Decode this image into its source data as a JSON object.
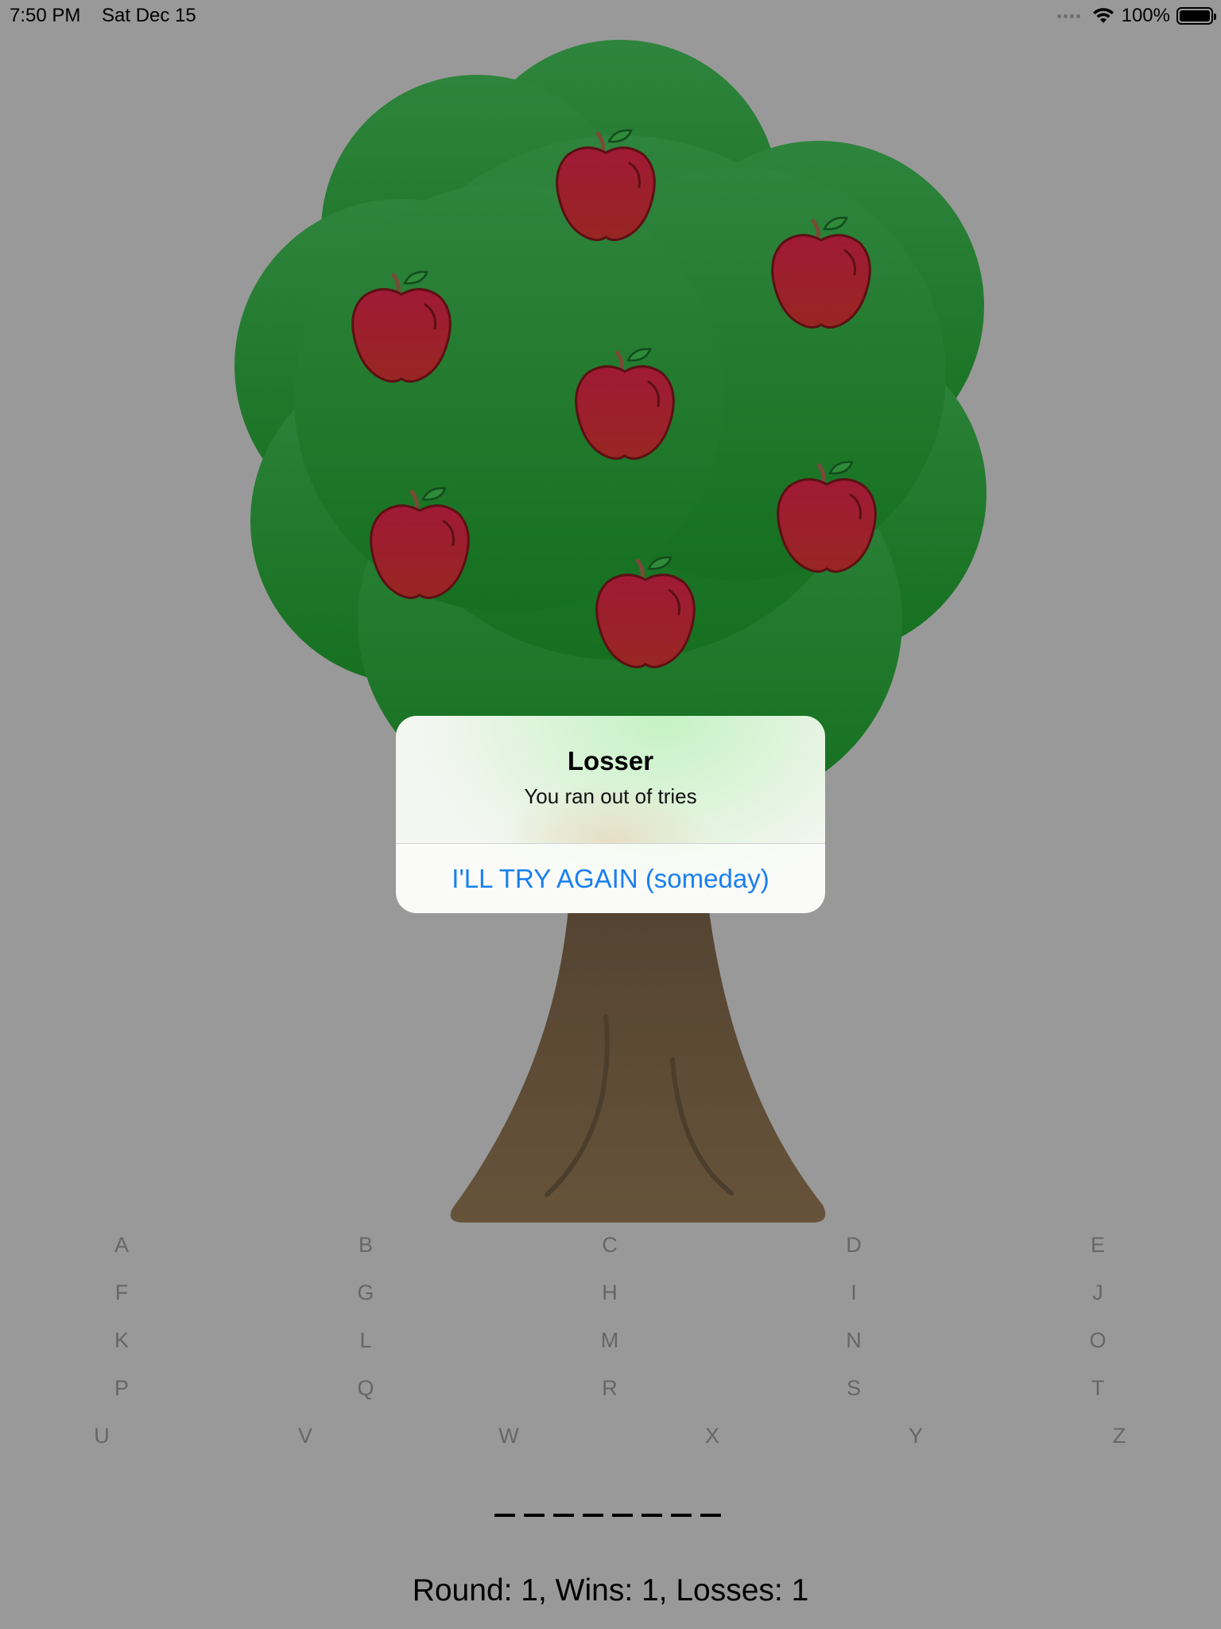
{
  "status_bar": {
    "time": "7:50 PM",
    "date": "Sat Dec 15",
    "battery": "100%",
    "wifi_icon": "wifi-icon",
    "signal_icon": "signal-dots-icon",
    "battery_icon": "battery-icon"
  },
  "scene": {
    "tree_icon": "apple-tree",
    "apple_count": 7,
    "colors": {
      "canopy_top": "#2e843c",
      "canopy_bottom": "#167020",
      "trunk": "#5e4e38",
      "apple": "#9e1a30"
    }
  },
  "alert": {
    "title": "Losser",
    "message": "You ran out of tries",
    "button_label": "I'LL TRY AGAIN (someday)",
    "button_color": "#1a7ff0"
  },
  "keyboard": {
    "rows": [
      [
        "A",
        "B",
        "C",
        "D",
        "E"
      ],
      [
        "F",
        "G",
        "H",
        "I",
        "J"
      ],
      [
        "K",
        "L",
        "M",
        "N",
        "O"
      ],
      [
        "P",
        "Q",
        "R",
        "S",
        "T"
      ],
      [
        "U",
        "V",
        "W",
        "X",
        "Y",
        "Z"
      ]
    ]
  },
  "word": {
    "display": "_ _ _ _ _ _ _ _",
    "letter_count": 8
  },
  "score": {
    "text": "Round: 1, Wins: 1, Losses: 1"
  }
}
